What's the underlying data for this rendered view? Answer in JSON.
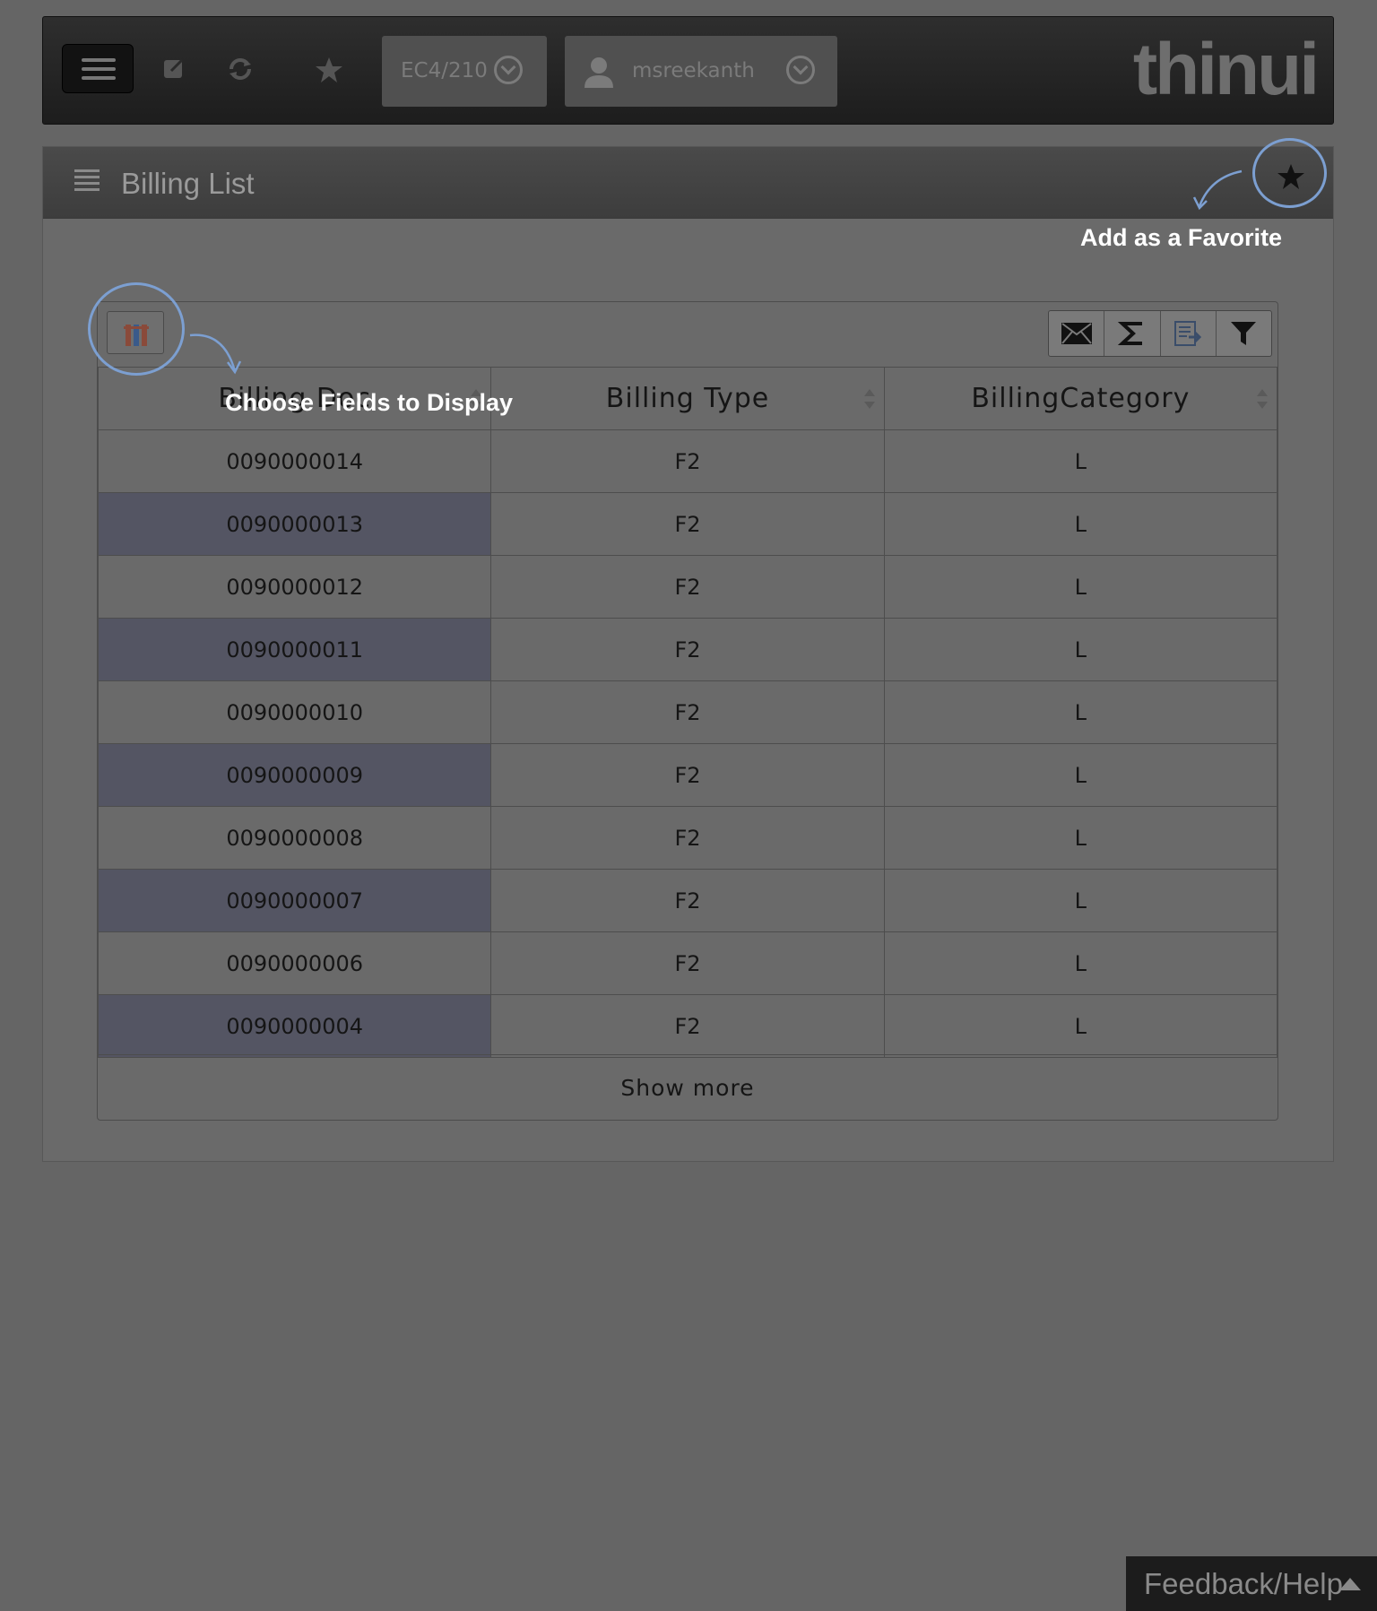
{
  "topbar": {
    "system_select": "EC4/210",
    "user_select": "msreekanth",
    "logo": "thinui"
  },
  "panel": {
    "title": "Billing List"
  },
  "annotations": {
    "favorite": "Add as a Favorite",
    "fields": "Choose Fields to Display"
  },
  "table": {
    "columns": [
      "Billing Doc",
      "Billing Type",
      "BillingCategory"
    ],
    "rows": [
      [
        "0090000014",
        "F2",
        "L"
      ],
      [
        "0090000013",
        "F2",
        "L"
      ],
      [
        "0090000012",
        "F2",
        "L"
      ],
      [
        "0090000011",
        "F2",
        "L"
      ],
      [
        "0090000010",
        "F2",
        "L"
      ],
      [
        "0090000009",
        "F2",
        "L"
      ],
      [
        "0090000008",
        "F2",
        "L"
      ],
      [
        "0090000007",
        "F2",
        "L"
      ],
      [
        "0090000006",
        "F2",
        "L"
      ],
      [
        "0090000004",
        "F2",
        "L"
      ]
    ],
    "show_more": "Show more"
  },
  "toolbar": {
    "icons": [
      "mail-icon",
      "sum-icon",
      "export-icon",
      "filter-icon"
    ]
  },
  "feedback": {
    "label": "Feedback/Help"
  },
  "colors": {
    "annotation_circle": "#7c9fd1",
    "selected_cell": "#545563"
  }
}
